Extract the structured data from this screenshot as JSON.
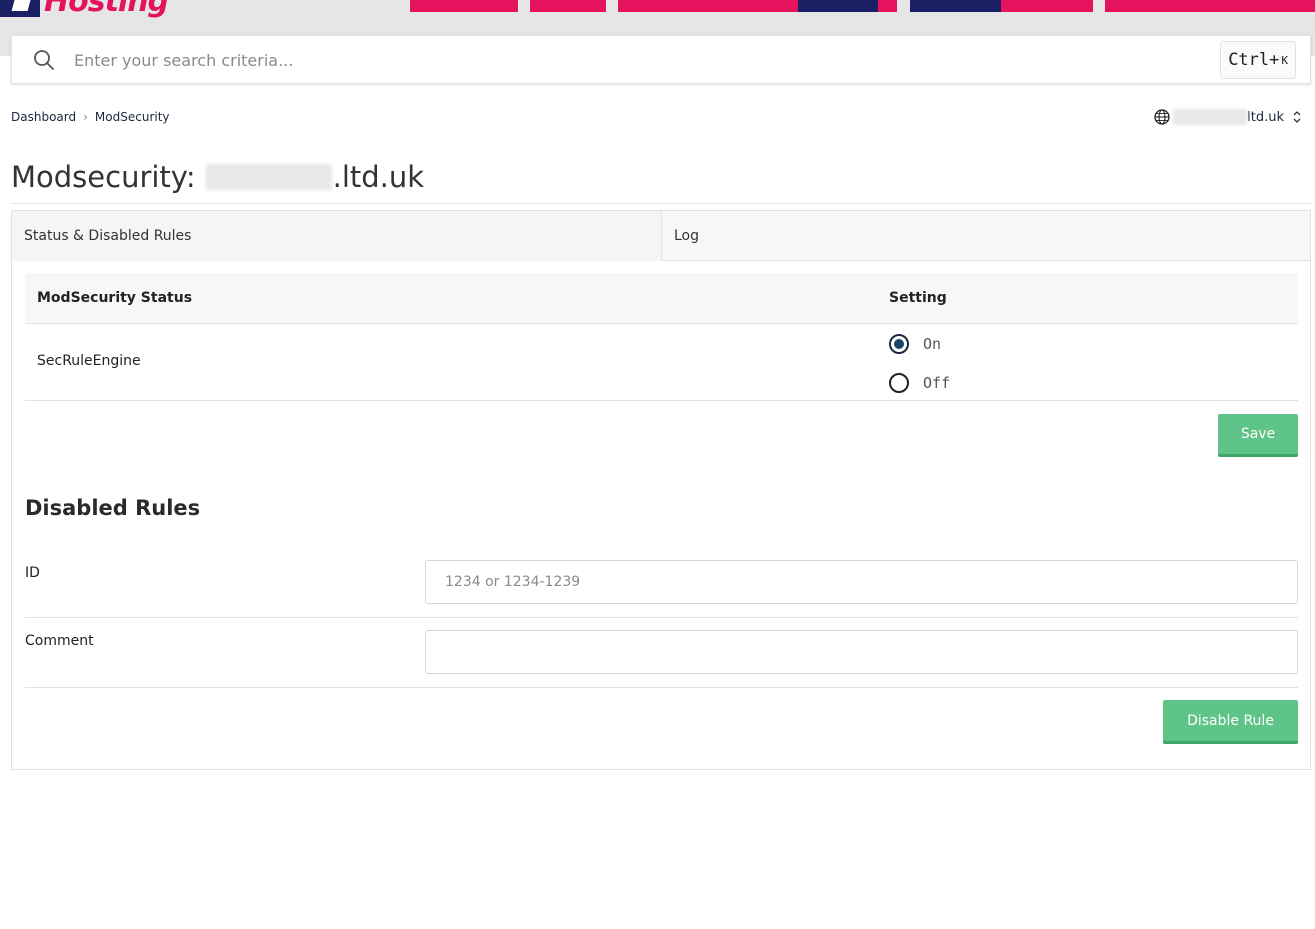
{
  "header": {
    "logo_text": "Hosting"
  },
  "search": {
    "placeholder": "Enter your search criteria...",
    "shortcut_main": "Ctrl+",
    "shortcut_key": "K"
  },
  "breadcrumb": {
    "items": [
      "Dashboard",
      "ModSecurity"
    ]
  },
  "domain_selector": {
    "visible_suffix": "ltd.uk"
  },
  "page": {
    "title_prefix": "Modsecurity:",
    "title_suffix": ".ltd.uk"
  },
  "tabs": [
    {
      "label": "Status & Disabled Rules",
      "active": true
    },
    {
      "label": "Log",
      "active": false
    }
  ],
  "status_table": {
    "headers": [
      "ModSecurity Status",
      "Setting"
    ],
    "rows": [
      {
        "name": "SecRuleEngine",
        "options": [
          {
            "label": "On",
            "checked": true
          },
          {
            "label": "Off",
            "checked": false
          }
        ]
      }
    ],
    "save_label": "Save"
  },
  "disabled_rules": {
    "title": "Disabled Rules",
    "id_label": "ID",
    "id_placeholder": "1234 or 1234-1239",
    "id_value": "",
    "comment_label": "Comment",
    "comment_value": "",
    "submit_label": "Disable Rule"
  },
  "colors": {
    "brand_pink": "#e5125e",
    "brand_navy": "#1a2063",
    "button_green": "#5ec487"
  }
}
